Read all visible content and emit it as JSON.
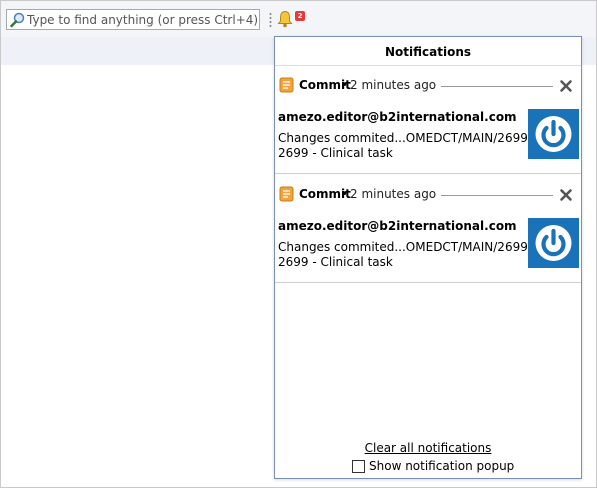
{
  "search": {
    "placeholder": "Type to find anything (or press Ctrl+4)"
  },
  "notifications_badge": {
    "count": "2",
    "color": "#e8393a"
  },
  "popup": {
    "title": "Notifications",
    "items": [
      {
        "type": "Commit",
        "separator": "•",
        "time": "2 minutes ago",
        "author": "amezo.editor@b2international.com",
        "message_line1": "Changes commited...OMEDCT/MAIN/2699",
        "message_line2": "2699 - Clinical task",
        "icon": "commit-icon",
        "thumbnail": "power-logo"
      },
      {
        "type": "Commit",
        "separator": "•",
        "time": "2 minutes ago",
        "author": "amezo.editor@b2international.com",
        "message_line1": "Changes commited...OMEDCT/MAIN/2699",
        "message_line2": "2699 - Clinical task",
        "icon": "commit-icon",
        "thumbnail": "power-logo"
      }
    ],
    "clear_label": "Clear all notifications",
    "show_popup_label": "Show notification popup",
    "show_popup_checked": false
  },
  "colors": {
    "thumbnail_blue": "#1a72b8",
    "popup_border": "#7a8fb5",
    "commit_orange": "#f2a33a"
  }
}
